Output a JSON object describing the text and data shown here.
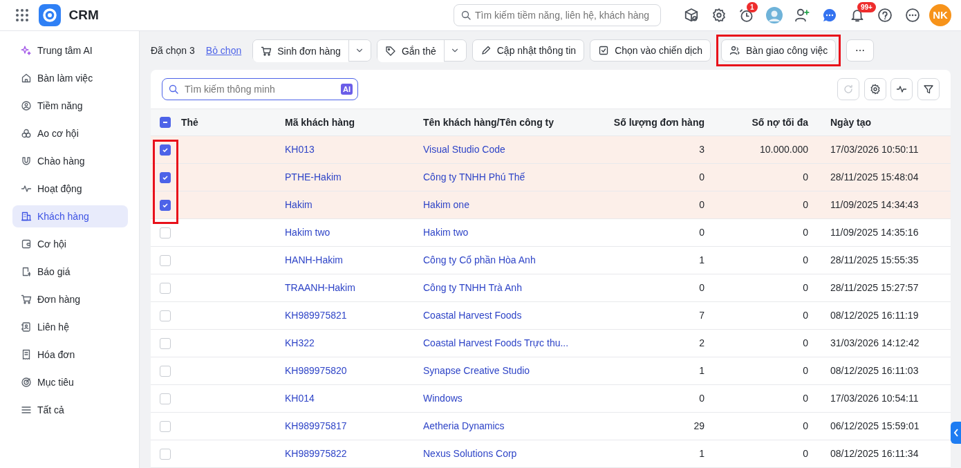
{
  "app": {
    "title": "CRM",
    "search_placeholder": "Tìm kiếm tiềm năng, liên hệ, khách hàng",
    "timer_badge": "1",
    "notification_badge": "99+",
    "avatar_initials": "NK"
  },
  "sidebar": {
    "items": [
      {
        "label": "Trung tâm AI",
        "selected": false
      },
      {
        "label": "Bàn làm việc",
        "selected": false
      },
      {
        "label": "Tiềm năng",
        "selected": false
      },
      {
        "label": "Ao cơ hội",
        "selected": false
      },
      {
        "label": "Chào hàng",
        "selected": false
      },
      {
        "label": "Hoạt động",
        "selected": false
      },
      {
        "label": "Khách hàng",
        "selected": true
      },
      {
        "label": "Cơ hội",
        "selected": false
      },
      {
        "label": "Báo giá",
        "selected": false
      },
      {
        "label": "Đơn hàng",
        "selected": false
      },
      {
        "label": "Liên hệ",
        "selected": false
      },
      {
        "label": "Hóa đơn",
        "selected": false
      },
      {
        "label": "Mục tiêu",
        "selected": false
      },
      {
        "label": "Tất cả",
        "selected": false
      }
    ]
  },
  "selection_bar": {
    "count_text": "Đã chọn 3",
    "clear_link": "Bỏ chọn",
    "actions": [
      {
        "label": "Sinh đơn hàng",
        "has_dropdown": true,
        "highlighted": false
      },
      {
        "label": "Gắn thẻ",
        "has_dropdown": true,
        "highlighted": false
      },
      {
        "label": "Cập nhật thông tin",
        "has_dropdown": false,
        "highlighted": false
      },
      {
        "label": "Chọn vào chiến dịch",
        "has_dropdown": false,
        "highlighted": false
      },
      {
        "label": "Bàn giao công việc",
        "has_dropdown": false,
        "highlighted": true
      }
    ],
    "more": "⋯"
  },
  "table": {
    "search_placeholder": "Tìm kiếm thông minh",
    "ai_badge": "AI",
    "checked_rows_highlighted": true,
    "select_all_indeterminate": true,
    "columns": [
      "Thẻ",
      "Mã khách hàng",
      "Tên khách hàng/Tên công ty",
      "Số lượng đơn hàng",
      "Số nợ tối đa",
      "Ngày tạo"
    ],
    "rows": [
      {
        "selected": true,
        "code": "KH013",
        "name": "Visual Studio Code",
        "orders": "3",
        "max_debt": "10.000.000",
        "created": "17/03/2026 10:50:11"
      },
      {
        "selected": true,
        "code": "PTHE-Hakim",
        "name": "Công ty TNHH Phú Thế",
        "orders": "0",
        "max_debt": "0",
        "created": "28/11/2025 15:48:04"
      },
      {
        "selected": true,
        "code": "Hakim",
        "name": "Hakim one",
        "orders": "0",
        "max_debt": "0",
        "created": "11/09/2025 14:34:43"
      },
      {
        "selected": false,
        "code": "Hakim two",
        "name": "Hakim two",
        "orders": "0",
        "max_debt": "0",
        "created": "11/09/2025 14:35:16"
      },
      {
        "selected": false,
        "code": "HANH-Hakim",
        "name": "Công ty Cổ phần Hòa Anh",
        "orders": "1",
        "max_debt": "0",
        "created": "28/11/2025 15:55:35"
      },
      {
        "selected": false,
        "code": "TRAANH-Hakim",
        "name": "Công ty TNHH Trà Anh",
        "orders": "0",
        "max_debt": "0",
        "created": "28/11/2025 15:27:57"
      },
      {
        "selected": false,
        "code": "KH989975821",
        "name": "Coastal Harvest Foods",
        "orders": "7",
        "max_debt": "0",
        "created": "08/12/2025 16:11:19"
      },
      {
        "selected": false,
        "code": "KH322",
        "name": "Coastal Harvest Foods Trực thu...",
        "orders": "2",
        "max_debt": "0",
        "created": "31/03/2026 14:12:42"
      },
      {
        "selected": false,
        "code": "KH989975820",
        "name": "Synapse Creative Studio",
        "orders": "1",
        "max_debt": "0",
        "created": "08/12/2025 16:11:03"
      },
      {
        "selected": false,
        "code": "KH014",
        "name": "Windows",
        "orders": "0",
        "max_debt": "0",
        "created": "17/03/2026 10:54:11"
      },
      {
        "selected": false,
        "code": "KH989975817",
        "name": "Aetheria Dynamics",
        "orders": "29",
        "max_debt": "0",
        "created": "06/12/2025 15:59:01"
      },
      {
        "selected": false,
        "code": "KH989975822",
        "name": "Nexus Solutions Corp",
        "orders": "1",
        "max_debt": "0",
        "created": "08/12/2025 16:11:34"
      }
    ]
  }
}
